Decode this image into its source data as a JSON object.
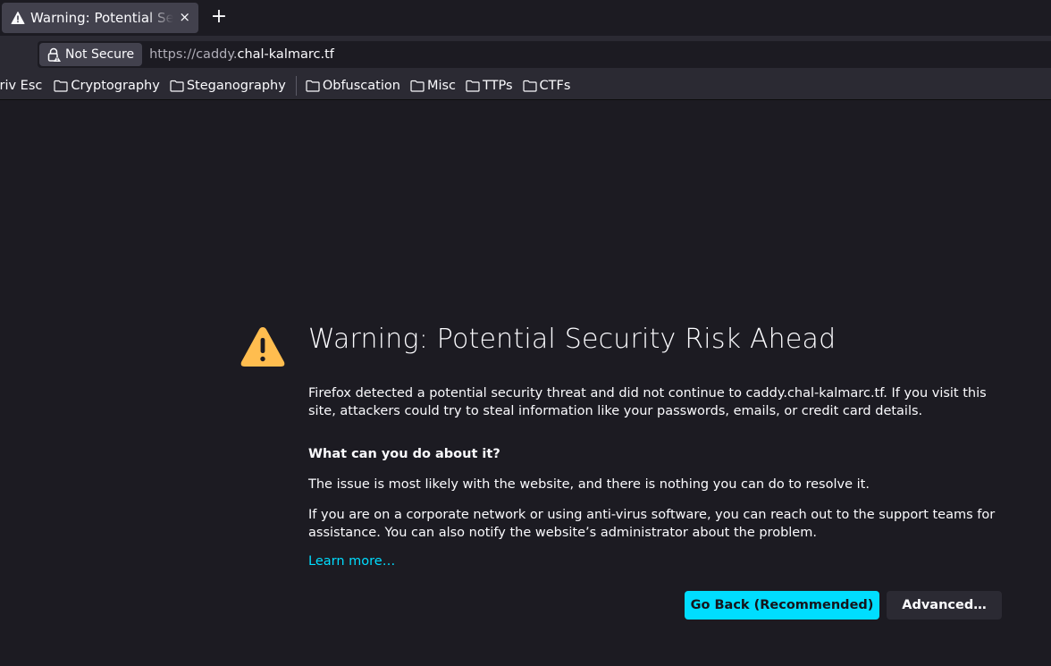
{
  "tab": {
    "title": "Warning: Potential Security Risk Ahead",
    "close_glyph": "×",
    "new_tab_glyph": "+"
  },
  "navbar": {
    "identity_label": "Not Secure",
    "url_prefix": "https://caddy.",
    "url_host": "chal-kalmarc.tf"
  },
  "bookmarks": {
    "partial_item": "Priv Esc",
    "folders_group1": [
      "Cryptography",
      "Steganography"
    ],
    "folders_group2": [
      "Obfuscation",
      "Misc",
      "TTPs",
      "CTFs"
    ]
  },
  "page": {
    "title": "Warning: Potential Security Risk Ahead",
    "intro": "Firefox detected a potential security threat and did not continue to caddy.chal-kalmarc.tf. If you visit this site, attackers could try to steal information like your passwords, emails, or credit card details.",
    "heading": "What can you do about it?",
    "issue_text": "The issue is most likely with the website, and there is nothing you can do to resolve it.",
    "corporate_text": "If you are on a corporate network or using anti-virus software, you can reach out to the support teams for assistance. You can also notify the website’s administrator about the problem.",
    "learn_more": "Learn more…",
    "go_back_button": "Go Back (Recommended)",
    "advanced_button": "Advanced…"
  },
  "colors": {
    "accent": "#00ddff",
    "warning": "#ffbd4f",
    "background": "#1c1b22",
    "toolbar": "#2b2a33"
  },
  "icons": [
    "warning-icon",
    "close-icon",
    "plus-icon",
    "lock-warning-icon",
    "folder-icon"
  ]
}
